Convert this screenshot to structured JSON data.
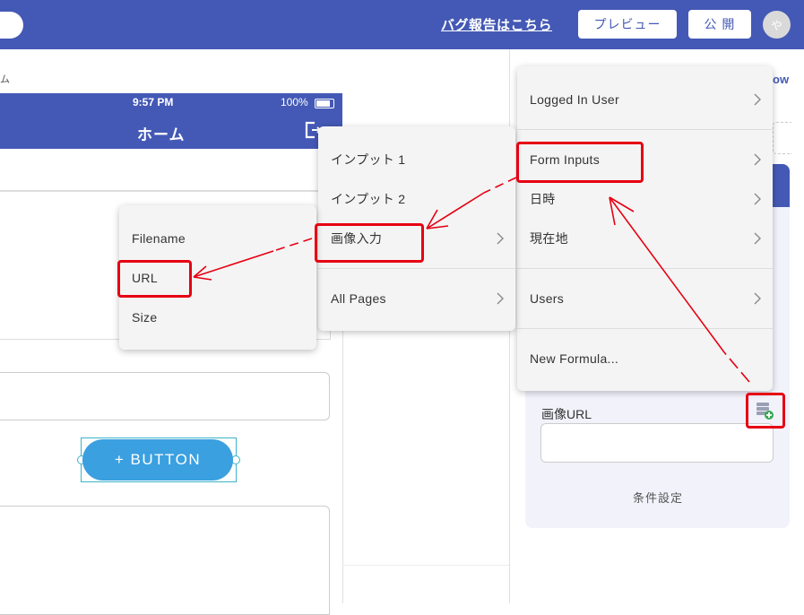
{
  "topbar": {
    "bug_link": "バグ報告はこちら",
    "preview_button": "プレビュー",
    "publish_button": "公 開",
    "avatar_initial": "や"
  },
  "canvas": {
    "label": "ム",
    "status_time": "9:57 PM",
    "status_battery": "100%",
    "screen_title": "ホーム",
    "button_label": "+ BUTTON"
  },
  "right_panel": {
    "tab_label": "ow",
    "image_url_label": "画像URL",
    "condition_label": "条件設定"
  },
  "menu_main": {
    "items": [
      {
        "label": "Logged In User",
        "has_submenu": true
      },
      {
        "label": "Form Inputs",
        "has_submenu": true
      },
      {
        "label": "日時",
        "has_submenu": true
      },
      {
        "label": "現在地",
        "has_submenu": true
      },
      {
        "label": "Users",
        "has_submenu": true
      },
      {
        "label": "New Formula...",
        "has_submenu": false
      }
    ]
  },
  "menu_form_inputs": {
    "items": [
      {
        "label": "インプット 1",
        "has_submenu": false
      },
      {
        "label": "インプット 2",
        "has_submenu": false
      },
      {
        "label": "画像入力",
        "has_submenu": true
      },
      {
        "label": "All Pages",
        "has_submenu": true
      }
    ]
  },
  "menu_image_input": {
    "items": [
      {
        "label": "Filename"
      },
      {
        "label": "URL"
      },
      {
        "label": "Size"
      }
    ]
  },
  "colors": {
    "primary": "#4459b5",
    "highlight": "#e60012",
    "button": "#3aa0e0"
  }
}
